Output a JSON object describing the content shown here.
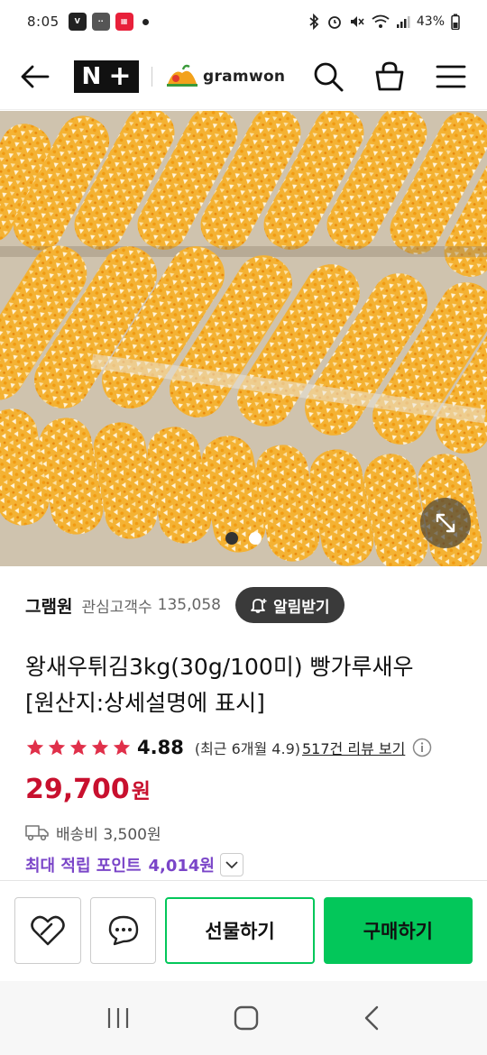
{
  "status_bar": {
    "time": "8:05",
    "battery": "43%",
    "icons": [
      "app-icon-v",
      "app-icon-gray",
      "app-icon-red",
      "notification-dot",
      "bluetooth-icon",
      "alarm-icon",
      "mute-icon",
      "wifi-icon",
      "signal-icon",
      "battery-icon"
    ]
  },
  "header": {
    "logo": "N+",
    "brand": "gramwon",
    "icons": [
      "back-arrow-icon",
      "search-icon",
      "cart-icon",
      "menu-icon"
    ]
  },
  "gallery": {
    "page_count": 2,
    "active_index": 0
  },
  "seller": {
    "name": "그램원",
    "fav_label": "관심고객수",
    "fav_count": "135,058",
    "alarm_label": "알림받기"
  },
  "product": {
    "title_line1": "왕새우튀김3kg(30g/100미) 빵가루새우",
    "title_line2": "[원산지:상세설명에 표시]",
    "rating": 4.88,
    "rating_text": "4.88",
    "recent_text": "(최근 6개월 4.9)",
    "review_link": "517건 리뷰 보기",
    "price": "29,700",
    "currency": "원",
    "shipping": "배송비 3,500원",
    "point_label": "최대 적립 포인트",
    "point_value": "4,014원"
  },
  "buybar": {
    "gift_label": "선물하기",
    "buy_label": "구매하기"
  },
  "colors": {
    "price": "#c8102e",
    "point": "#7a45c8",
    "accent_green": "#03c75a"
  }
}
